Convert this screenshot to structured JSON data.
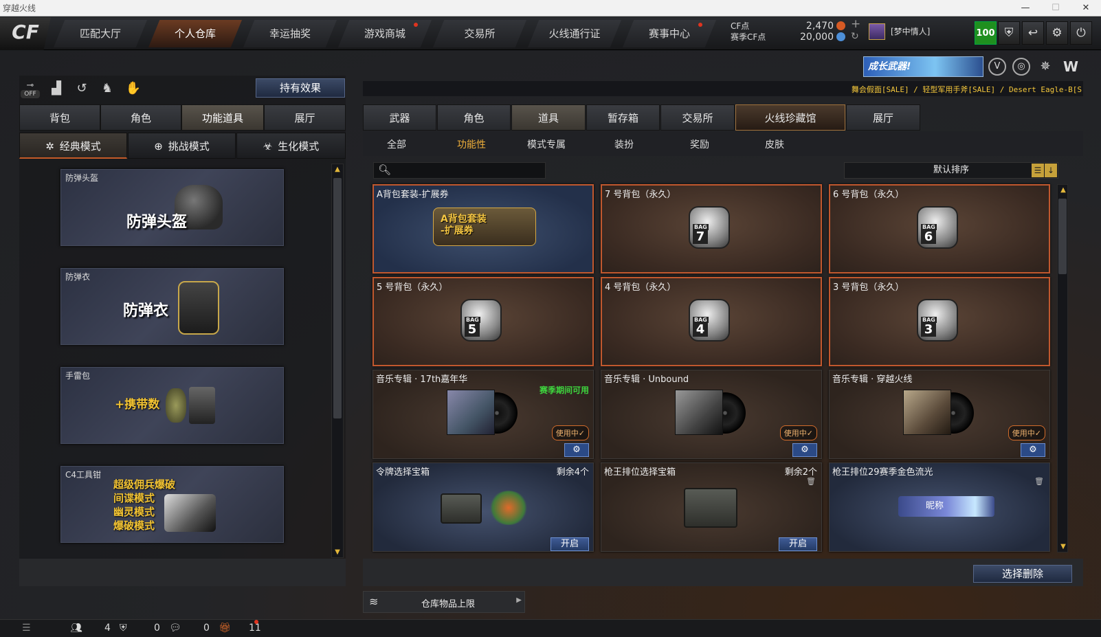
{
  "window": {
    "title": "穿越火线",
    "minimize": "—",
    "maximize": "☐",
    "close": "✕"
  },
  "logo": "CF",
  "nav": [
    {
      "label": "匹配大厅",
      "active": false,
      "dot": false
    },
    {
      "label": "个人仓库",
      "active": true,
      "dot": false
    },
    {
      "label": "幸运抽奖",
      "active": false,
      "dot": false
    },
    {
      "label": "游戏商城",
      "active": false,
      "dot": true
    },
    {
      "label": "交易所",
      "active": false,
      "dot": false
    },
    {
      "label": "火线通行证",
      "active": false,
      "dot": false
    },
    {
      "label": "赛事中心",
      "active": false,
      "dot": true
    }
  ],
  "currency": {
    "cf_label": "CF点",
    "cf_value": "2,470",
    "season_label": "赛季CF点",
    "season_value": "20,000",
    "plus": "+",
    "refresh": "↻"
  },
  "player": {
    "name": "[梦中情人]",
    "level": "100"
  },
  "banner": {
    "text": "成长武器!"
  },
  "ticker": "舞会假面[SALE] / 轻型军用手斧[SALE] / Desert Eagle-B[S",
  "left": {
    "effect_button": "持有效果",
    "off_label": "OFF",
    "tabs": [
      {
        "label": "背包",
        "active": false
      },
      {
        "label": "角色",
        "active": false
      },
      {
        "label": "功能道具",
        "active": true
      },
      {
        "label": "展厅",
        "active": false
      }
    ],
    "modes": [
      {
        "label": "经典模式",
        "icon": "✲",
        "active": true
      },
      {
        "label": "挑战模式",
        "icon": "⊕",
        "active": false
      },
      {
        "label": "生化模式",
        "icon": "☣",
        "active": false
      }
    ],
    "items": [
      {
        "title": "防弹头盔",
        "big": "防弹头盔"
      },
      {
        "title": "防弹衣",
        "big": "防弹衣"
      },
      {
        "title": "手雷包",
        "big": "+携带数"
      },
      {
        "title": "C4工具钳",
        "lines": [
          "超级佣兵爆破",
          "间谍模式",
          "幽灵模式",
          "爆破模式"
        ]
      }
    ]
  },
  "right": {
    "tabs": [
      {
        "label": "武器",
        "active": false
      },
      {
        "label": "角色",
        "active": false
      },
      {
        "label": "道具",
        "active": true
      },
      {
        "label": "暂存箱",
        "active": false
      },
      {
        "label": "交易所",
        "active": false
      },
      {
        "label": "火线珍藏馆",
        "active": false,
        "special": true
      },
      {
        "label": "展厅",
        "active": false
      }
    ],
    "subtabs": [
      {
        "label": "全部",
        "active": false
      },
      {
        "label": "功能性",
        "active": true
      },
      {
        "label": "模式专属",
        "active": false
      },
      {
        "label": "装扮",
        "active": false
      },
      {
        "label": "奖励",
        "active": false
      },
      {
        "label": "皮肤",
        "active": false
      }
    ],
    "search_placeholder": "",
    "sort_label": "默认排序",
    "cards": [
      {
        "title": "A背包套装-扩展券",
        "art": "A背包套装\n-扩展券"
      },
      {
        "title": "7 号背包（永久）",
        "bag": "7"
      },
      {
        "title": "6 号背包（永久）",
        "bag": "6"
      },
      {
        "title": "5 号背包（永久）",
        "bag": "5"
      },
      {
        "title": "4 号背包（永久）",
        "bag": "4"
      },
      {
        "title": "3 号背包（永久）",
        "bag": "3"
      },
      {
        "title": "音乐专辑 · 17th嘉年华",
        "note": "赛季期间可用",
        "inuse": "使用中✓"
      },
      {
        "title": "音乐专辑 · Unbound",
        "inuse": "使用中✓"
      },
      {
        "title": "音乐专辑 · 穿越火线",
        "inuse": "使用中✓"
      },
      {
        "title": "令牌选择宝箱",
        "remaining": "剩余4个",
        "open": "开启"
      },
      {
        "title": "枪王排位选择宝箱",
        "remaining": "剩余2个",
        "open": "开启"
      },
      {
        "title": "枪王排位29赛季金色流光",
        "nameplate": "昵称"
      }
    ],
    "select_delete": "选择删除",
    "capacity_label": "仓库物品上限"
  },
  "status": {
    "friends": "4",
    "messages": "0",
    "chat": "0",
    "gifts": "11"
  }
}
